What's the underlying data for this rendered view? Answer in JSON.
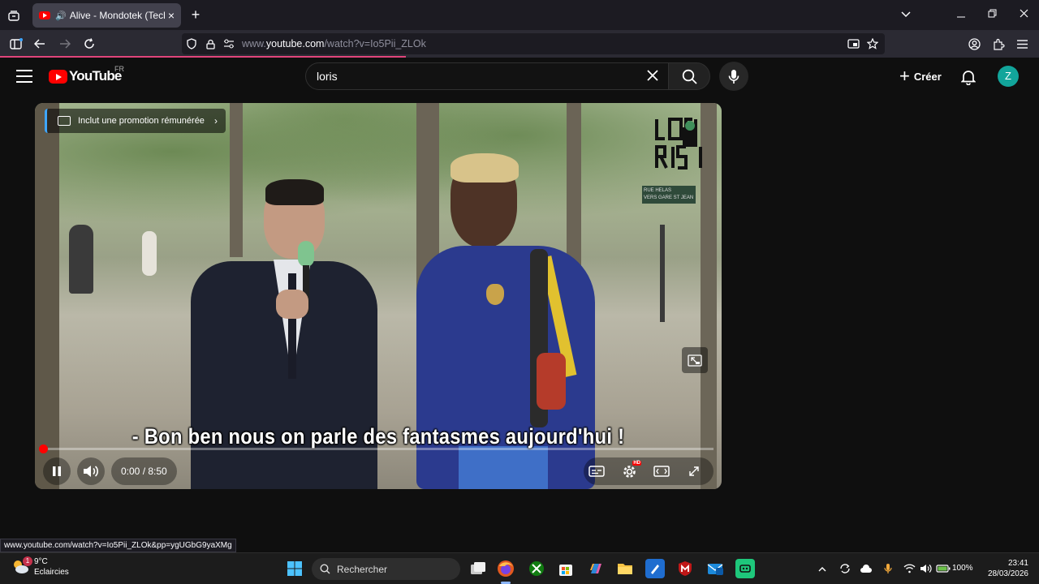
{
  "browser": {
    "tab": {
      "title": "Alive - Mondotek (Tecktonik",
      "close": "×"
    },
    "new_tab": "+",
    "url_prefix": "www.",
    "url_domain": "youtube.com",
    "url_path": "/watch?v=Io5Pii_ZLOk",
    "status_link": "www.youtube.com/watch?v=Io5Pii_ZLOk&pp=ygUGbG9yaXMg"
  },
  "youtube": {
    "logo_text": "YouTube",
    "country_code": "FR",
    "search_query": "loris",
    "create_label": "Créer",
    "avatar_letter": "Z",
    "accent_color": "#ff0000"
  },
  "player": {
    "promo_label": "Inclut une promotion rémunérée",
    "subtitle": "- Bon ben nous on parle des fantasmes aujourd'hui !",
    "time_display": "0:00 / 8:50",
    "progress_fraction": 0.0,
    "channel_logo": "lo RIS",
    "street_sign_line1": "RUE HELAS",
    "street_sign_line2": "VERS GARE ST JEAN"
  },
  "taskbar": {
    "weather_temp": "9°C",
    "weather_desc": "Eclaircies",
    "weather_badge": "1",
    "search_label": "Rechercher",
    "battery": "100%",
    "time": "23:41",
    "date": "28/03/2026"
  }
}
